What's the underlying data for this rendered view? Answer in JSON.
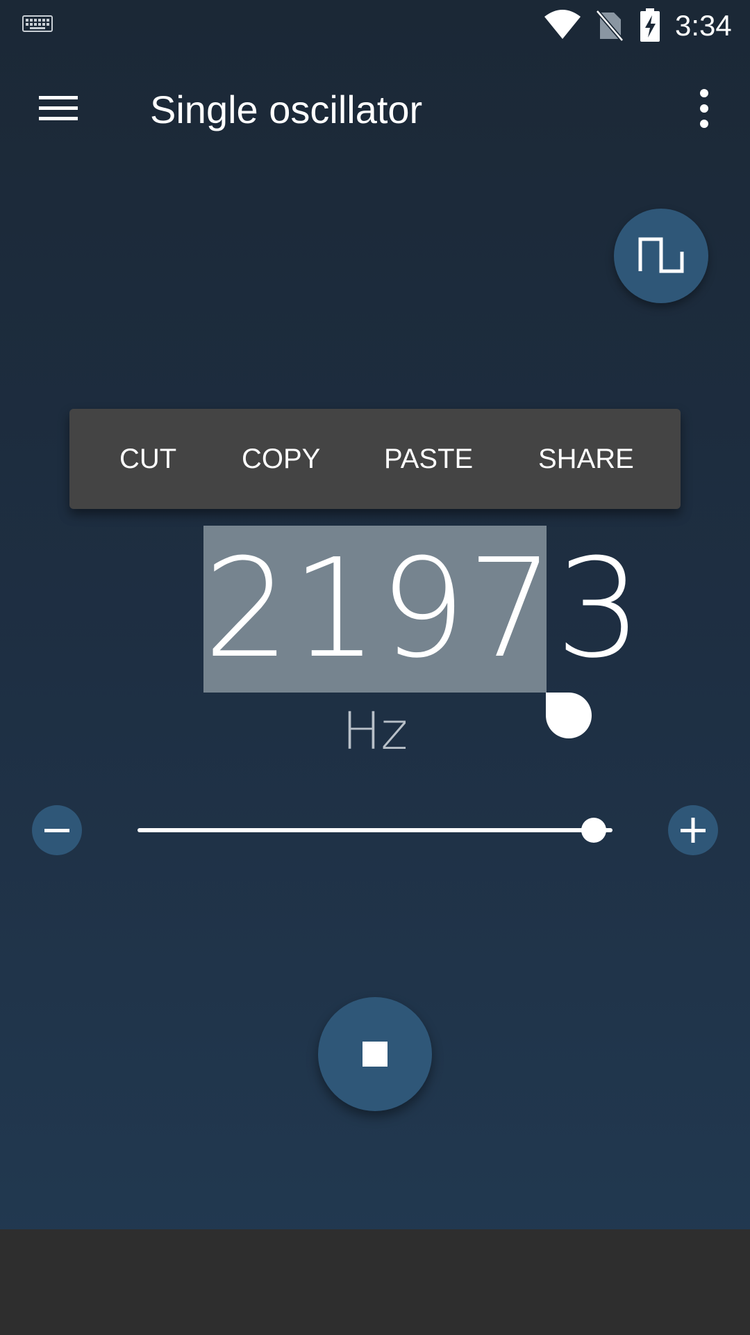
{
  "status_bar": {
    "time": "3:34",
    "icons": [
      "keyboard-icon",
      "wifi-icon",
      "no-sim-icon",
      "battery-charging-icon"
    ]
  },
  "app_bar": {
    "title": "Single oscillator",
    "nav_icon": "menu-icon",
    "overflow_icon": "more-vert-icon"
  },
  "waveform_button": {
    "icon": "square-wave-icon"
  },
  "context_menu": {
    "items": [
      "CUT",
      "COPY",
      "PASTE",
      "SHARE"
    ]
  },
  "frequency": {
    "value": "21973",
    "unit": "Hz"
  },
  "slider": {
    "decrease_icon": "minus-icon",
    "increase_icon": "plus-icon",
    "position_fraction": 0.96
  },
  "playback": {
    "icon": "stop-icon"
  },
  "colors": {
    "accent": "#2f5778",
    "selection": "#76848f",
    "menu_background": "#444444"
  }
}
